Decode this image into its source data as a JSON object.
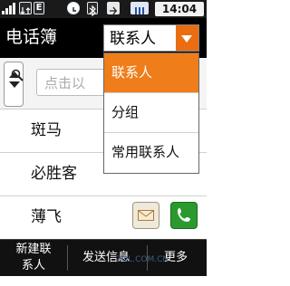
{
  "status_bar": {
    "time": "14:04",
    "icons": [
      "signal-icon",
      "data-icon",
      "e-icon",
      "clock-icon",
      "bluetooth-icon",
      "usb-icon",
      "sim-icon",
      "battery-icon"
    ],
    "e_label": "E"
  },
  "header": {
    "title": "电话簿",
    "filter_value": "联系人"
  },
  "search": {
    "placeholder": "点击以"
  },
  "contacts": [
    {
      "name": "斑马"
    },
    {
      "name": "必胜客"
    },
    {
      "name": "薄飞"
    }
  ],
  "dropdown": {
    "items": [
      {
        "label": "联系人",
        "selected": true
      },
      {
        "label": "分组",
        "selected": false
      },
      {
        "label": "常用联系人",
        "selected": false
      }
    ]
  },
  "bottom_bar": {
    "new_contact_line1": "新建联",
    "new_contact_line2": "系人",
    "send_message": "发送信息",
    "more": "更多"
  },
  "watermark": "ZOL.COM.CN",
  "colors": {
    "accent": "#ef7d1a",
    "call": "#2b9a2e"
  }
}
